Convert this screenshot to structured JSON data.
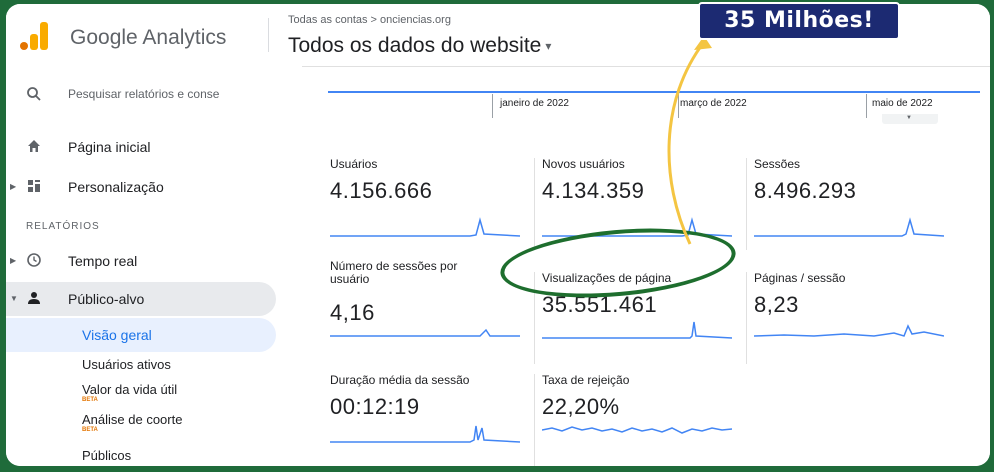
{
  "header": {
    "brand": "Google Analytics",
    "breadcrumb": "Todas as contas > onciencias.org",
    "account_view": "Todos os dados do website",
    "caret": "▾"
  },
  "annotation": {
    "badge": "35 Milhões!",
    "badge_color": "#1c2a72",
    "arrow_color": "#f4c542",
    "circle_color": "#1e6e2e"
  },
  "sidebar": {
    "search_placeholder": "Pesquisar relatórios e conse",
    "items": [
      {
        "label": "Página inicial",
        "icon": "home-icon"
      },
      {
        "label": "Personalização",
        "icon": "dashboard-icon"
      }
    ],
    "section_title": "RELATÓRIOS",
    "reports": [
      {
        "label": "Tempo real",
        "icon": "clock-icon"
      },
      {
        "label": "Público-alvo",
        "icon": "person-icon"
      }
    ],
    "audience_children": [
      {
        "label": "Visão geral",
        "selected": true
      },
      {
        "label": "Usuários ativos"
      },
      {
        "label": "Valor da vida útil",
        "beta": "BETA"
      },
      {
        "label": "Análise de coorte",
        "beta": "BETA"
      },
      {
        "label": "Públicos"
      }
    ]
  },
  "timeline": {
    "labels": [
      "janeiro de 2022",
      "março de 2022",
      "maio de 2022"
    ]
  },
  "metrics": [
    {
      "label": "Usuários",
      "value": "4.156.666"
    },
    {
      "label": "Novos usuários",
      "value": "4.134.359"
    },
    {
      "label": "Sessões",
      "value": "8.496.293"
    },
    {
      "label": "Número de sessões por usuário",
      "value": "4,16"
    },
    {
      "label": "Visualizações de página",
      "value": "35.551.461"
    },
    {
      "label": "Páginas / sessão",
      "value": "8,23"
    },
    {
      "label": "Duração média da sessão",
      "value": "00:12:19"
    },
    {
      "label": "Taxa de rejeição",
      "value": "22,20%"
    }
  ],
  "colors": {
    "accent": "#1a73e8",
    "sparkline": "#4285f4",
    "logo_orange": "#f9ab00",
    "logo_dark": "#e37400",
    "beta": "#e37400"
  }
}
